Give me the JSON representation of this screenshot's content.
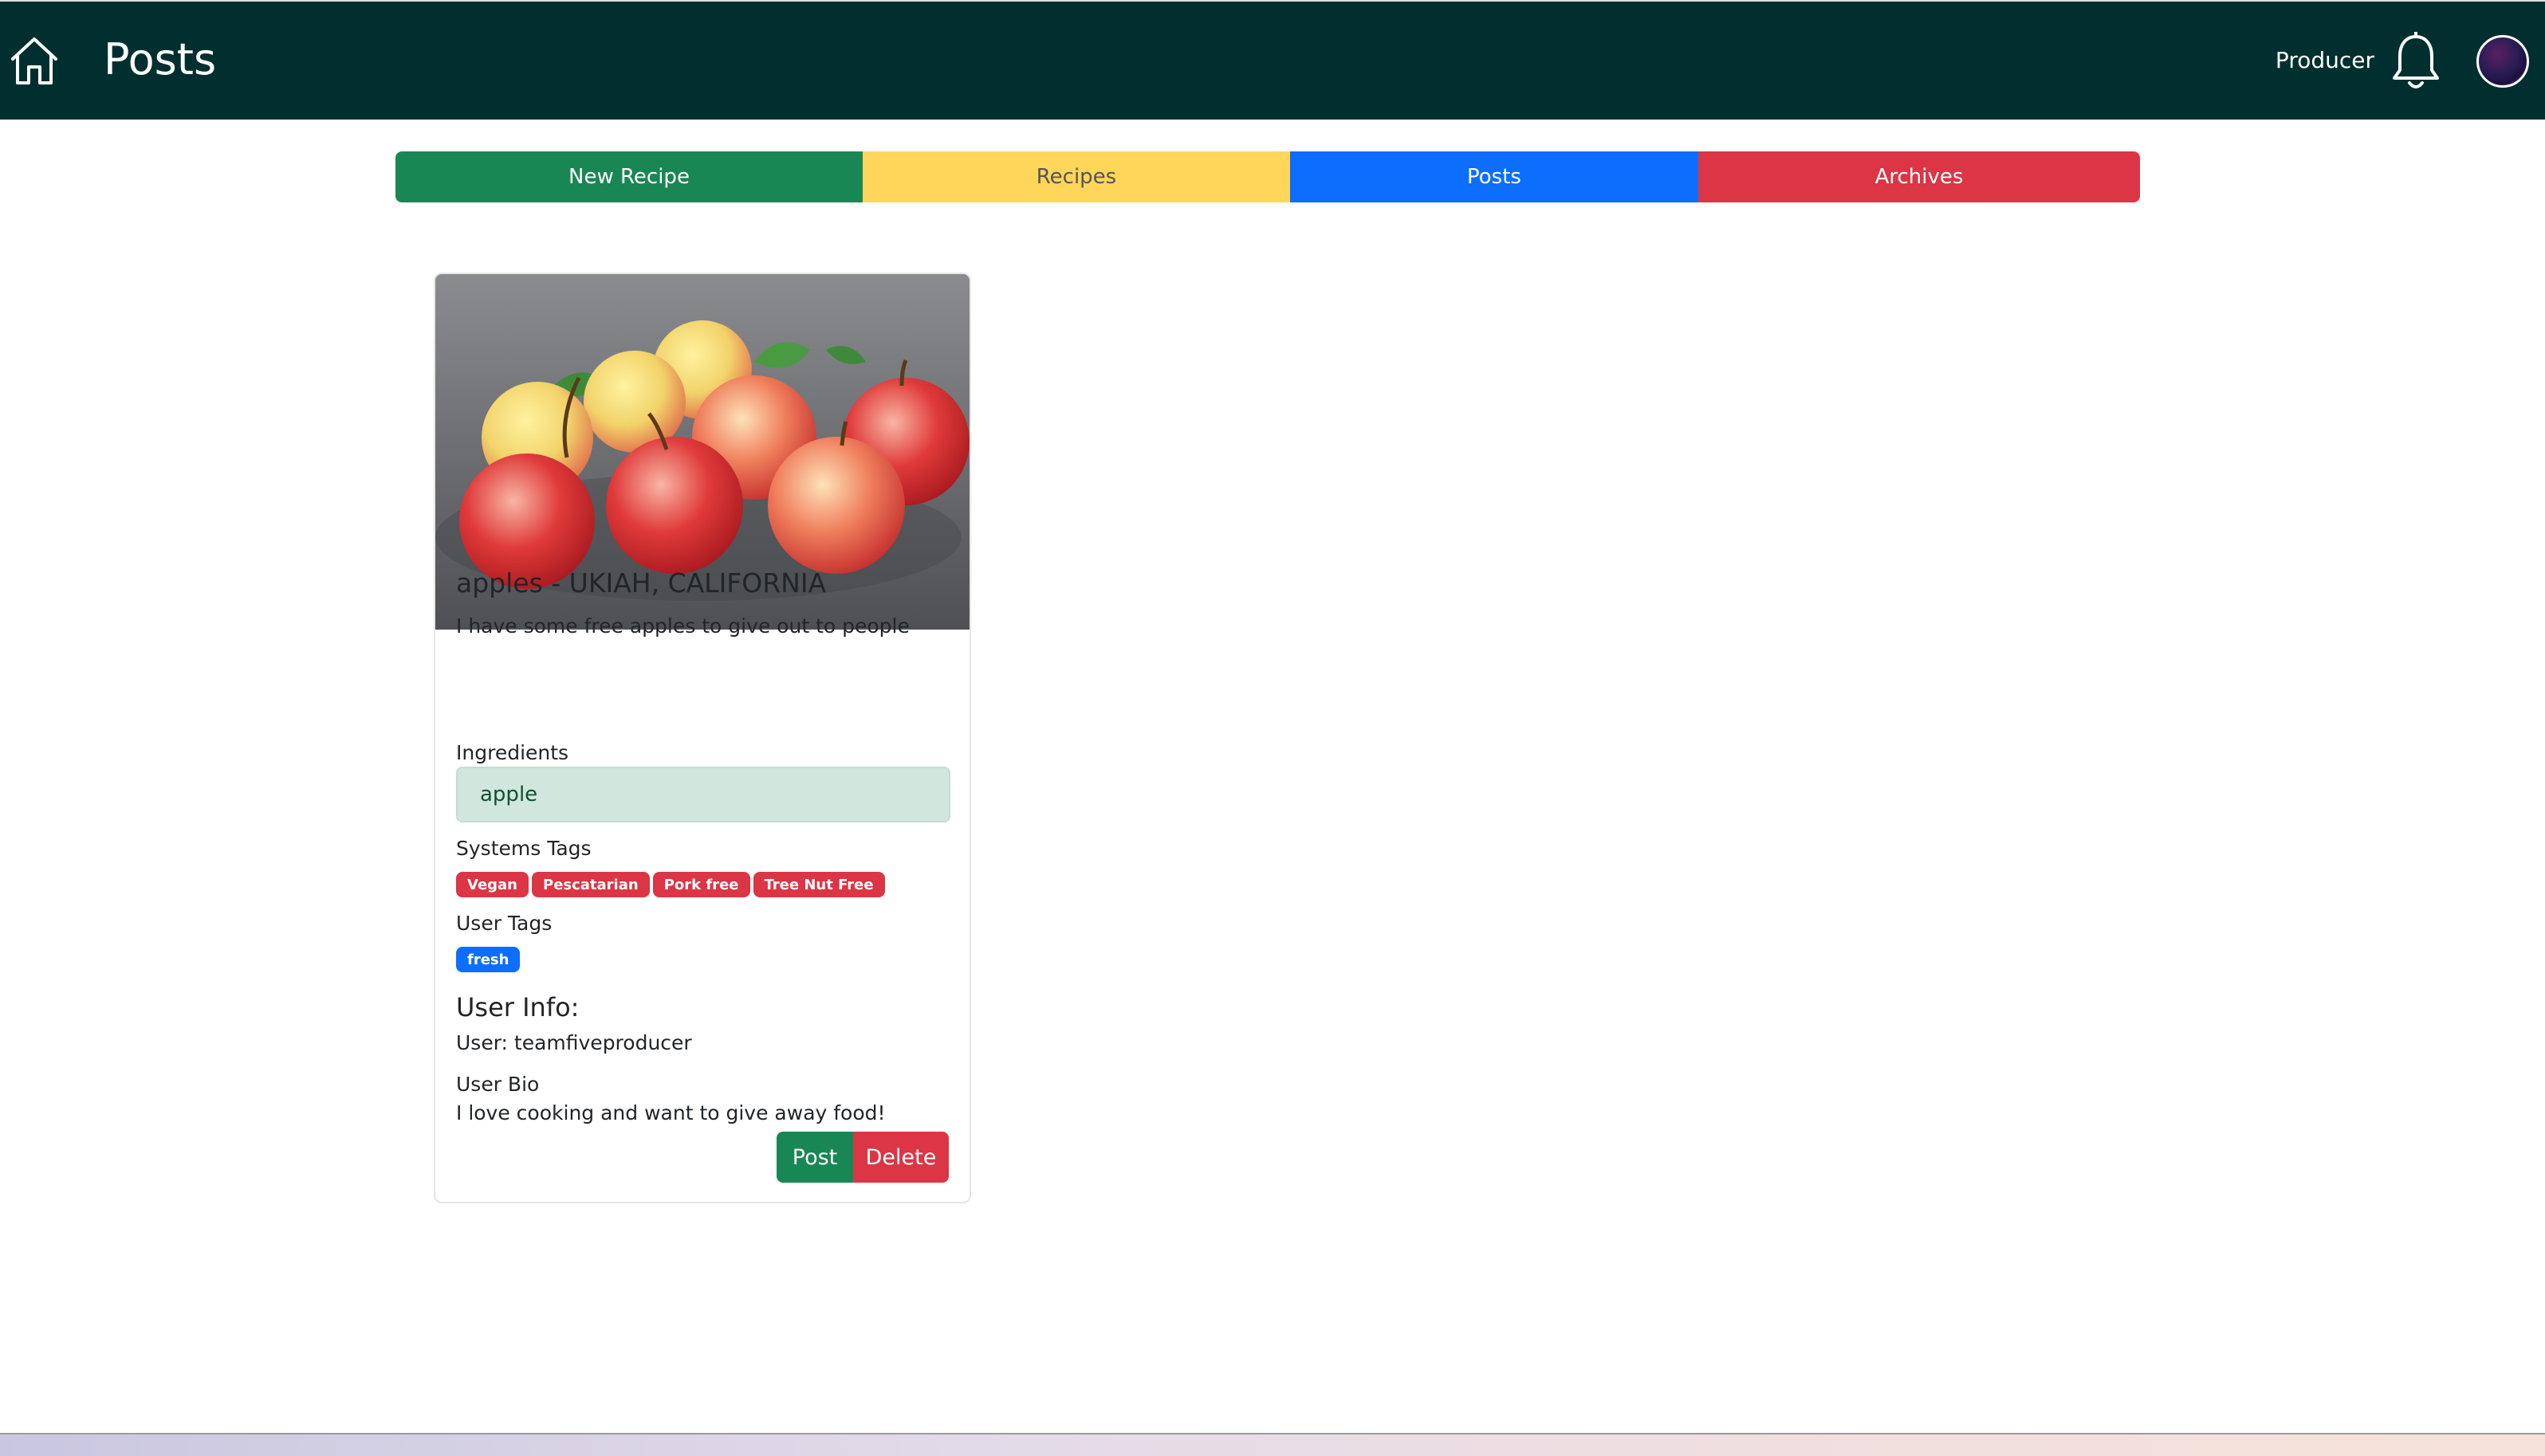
{
  "header": {
    "title": "Posts",
    "role": "Producer",
    "home_icon": "home-icon",
    "bell_icon": "bell-icon",
    "bg_color": "#012f2f"
  },
  "nav": {
    "new_recipe": "New Recipe",
    "recipes": "Recipes",
    "posts": "Posts",
    "archives": "Archives",
    "colors": {
      "new_recipe": "#198754",
      "recipes": "#ffd65a",
      "posts": "#0d6efd",
      "archives": "#dc3545"
    }
  },
  "post": {
    "title": "apples - UKIAH, CALIFORNIA",
    "description": "I have some free apples to give out to people",
    "ingredients_label": "Ingredients",
    "ingredients": [
      "apple"
    ],
    "system_tags_label": "Systems Tags",
    "system_tags": [
      "Vegan",
      "Pescatarian",
      "Pork free",
      "Tree Nut Free"
    ],
    "user_tags_label": "User Tags",
    "user_tags": [
      "fresh"
    ],
    "user_info_title": "User Info:",
    "user_line": "User: teamfiveproducer",
    "bio_label": "User Bio",
    "bio": "I love cooking and want to give away food!",
    "post_button": "Post",
    "delete_button": "Delete"
  }
}
